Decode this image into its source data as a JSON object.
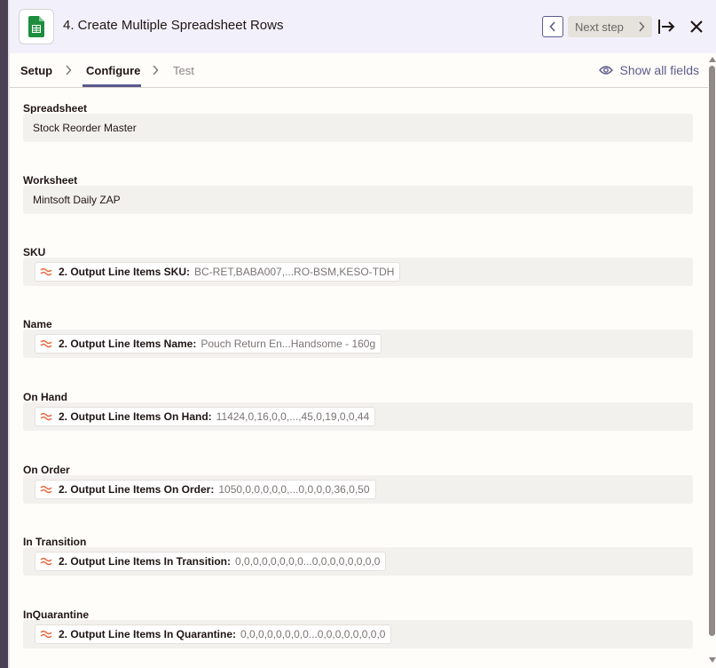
{
  "header": {
    "app_icon": "google-sheets-icon",
    "step_title": "4. Create Multiple Spreadsheet Rows",
    "next_step_label": "Next step"
  },
  "tabs": {
    "items": [
      {
        "label": "Setup"
      },
      {
        "label": "Configure"
      },
      {
        "label": "Test"
      }
    ],
    "active": "Configure",
    "show_all_fields_label": "Show all fields"
  },
  "fields": [
    {
      "label": "Spreadsheet",
      "value": "Stock Reorder Master"
    },
    {
      "label": "Worksheet",
      "value": "Mintsoft Daily ZAP"
    },
    {
      "label": "SKU",
      "pill_label": "2. Output Line Items SKU:",
      "pill_value": "BC-RET,BABA007,...RO-BSM,KESO-TDH"
    },
    {
      "label": "Name",
      "pill_label": "2. Output Line Items Name:",
      "pill_value": "Pouch Return En...Handsome - 160g"
    },
    {
      "label": "On Hand",
      "pill_label": "2. Output Line Items On Hand:",
      "pill_value": "11424,0,16,0,0,...,45,0,19,0,0,44"
    },
    {
      "label": "On Order",
      "pill_label": "2. Output Line Items On Order:",
      "pill_value": "1050,0,0,0,0,0,...0,0,0,0,36,0,50"
    },
    {
      "label": "In Transition",
      "pill_label": "2. Output Line Items In Transition:",
      "pill_value": "0,0,0,0,0,0,0,0...0,0,0,0,0,0,0,0"
    },
    {
      "label": "InQuarantine",
      "pill_label": "2. Output Line Items In Quarantine:",
      "pill_value": "0,0,0,0,0,0,0,0...0,0,0,0,0,0,0,0"
    }
  ],
  "colors": {
    "accent": "#5b5a8c",
    "sheets_green": "#1e8e3e",
    "pill_icon_orange": "#e8653a"
  }
}
